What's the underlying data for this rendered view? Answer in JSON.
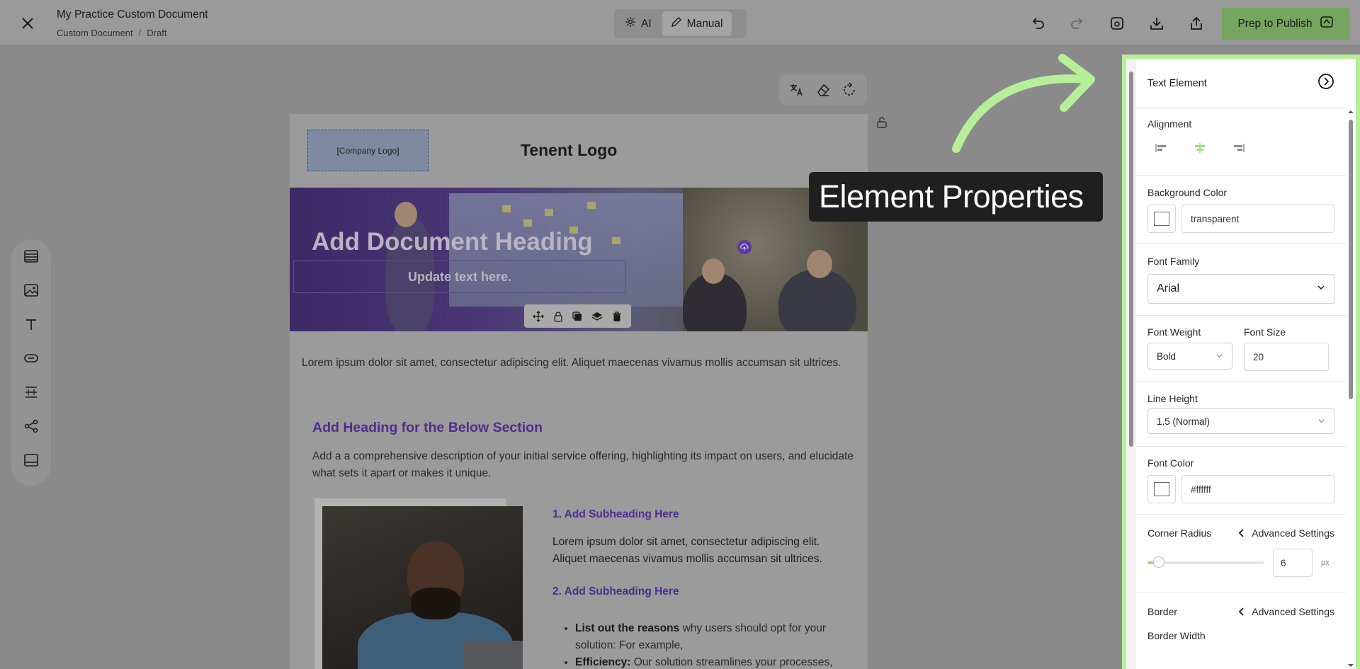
{
  "topbar": {
    "doc_title": "My Practice Custom Document",
    "crumb_type": "Custom Document",
    "crumb_sep": "/",
    "crumb_status": "Draft",
    "mode_ai": "AI",
    "mode_manual": "Manual",
    "publish_label": "Prep to Publish"
  },
  "document": {
    "logo_placeholder": "[Company Logo]",
    "tenant_logo": "Tenent Logo",
    "hero_heading": "Add Document Heading",
    "hero_sub": "Update text here.",
    "intro_paragraph": "Lorem ipsum dolor sit amet, consectetur adipiscing elit. Aliquet maecenas vivamus mollis accumsan sit ultrices.",
    "section_heading": "Add Heading for the Below Section",
    "section_desc": "Add a a comprehensive description of your initial service offering, highlighting its impact on users, and elucidate what sets it apart or makes it unique.",
    "sub1_heading": "1. Add Subheading Here",
    "sub1_text": "Lorem ipsum dolor sit amet, consectetur adipiscing elit. Aliquet maecenas vivamus mollis accumsan sit ultrices.",
    "sub2_heading": "2. Add Subheading Here",
    "bullet1_bold": "List out the reasons",
    "bullet1_rest": " why users should opt for your solution: For example,",
    "bullet2_bold": "Efficiency:",
    "bullet2_rest": " Our solution streamlines your processes,"
  },
  "callout": {
    "text": "Element Properties"
  },
  "panel": {
    "title": "Text Element",
    "alignment_label": "Alignment",
    "alignment_selected": "center",
    "bg_color_label": "Background Color",
    "bg_color_value": "transparent",
    "font_family_label": "Font Family",
    "font_family_value": "Arial",
    "font_weight_label": "Font Weight",
    "font_weight_value": "Bold",
    "font_size_label": "Font Size",
    "font_size_value": "20",
    "line_height_label": "Line Height",
    "line_height_value": "1.5 (Normal)",
    "font_color_label": "Font Color",
    "font_color_value": "#ffffff",
    "corner_radius_label": "Corner Radius",
    "advanced_label": "Advanced Settings",
    "corner_radius_value": "6",
    "corner_radius_unit": "px",
    "border_label": "Border",
    "border_advanced_label": "Advanced Settings",
    "border_width_label": "Border Width"
  },
  "colors": {
    "accent_green": "#b7ef99",
    "publish_green": "#75a55e",
    "heading_purple": "#4b2f8f"
  }
}
